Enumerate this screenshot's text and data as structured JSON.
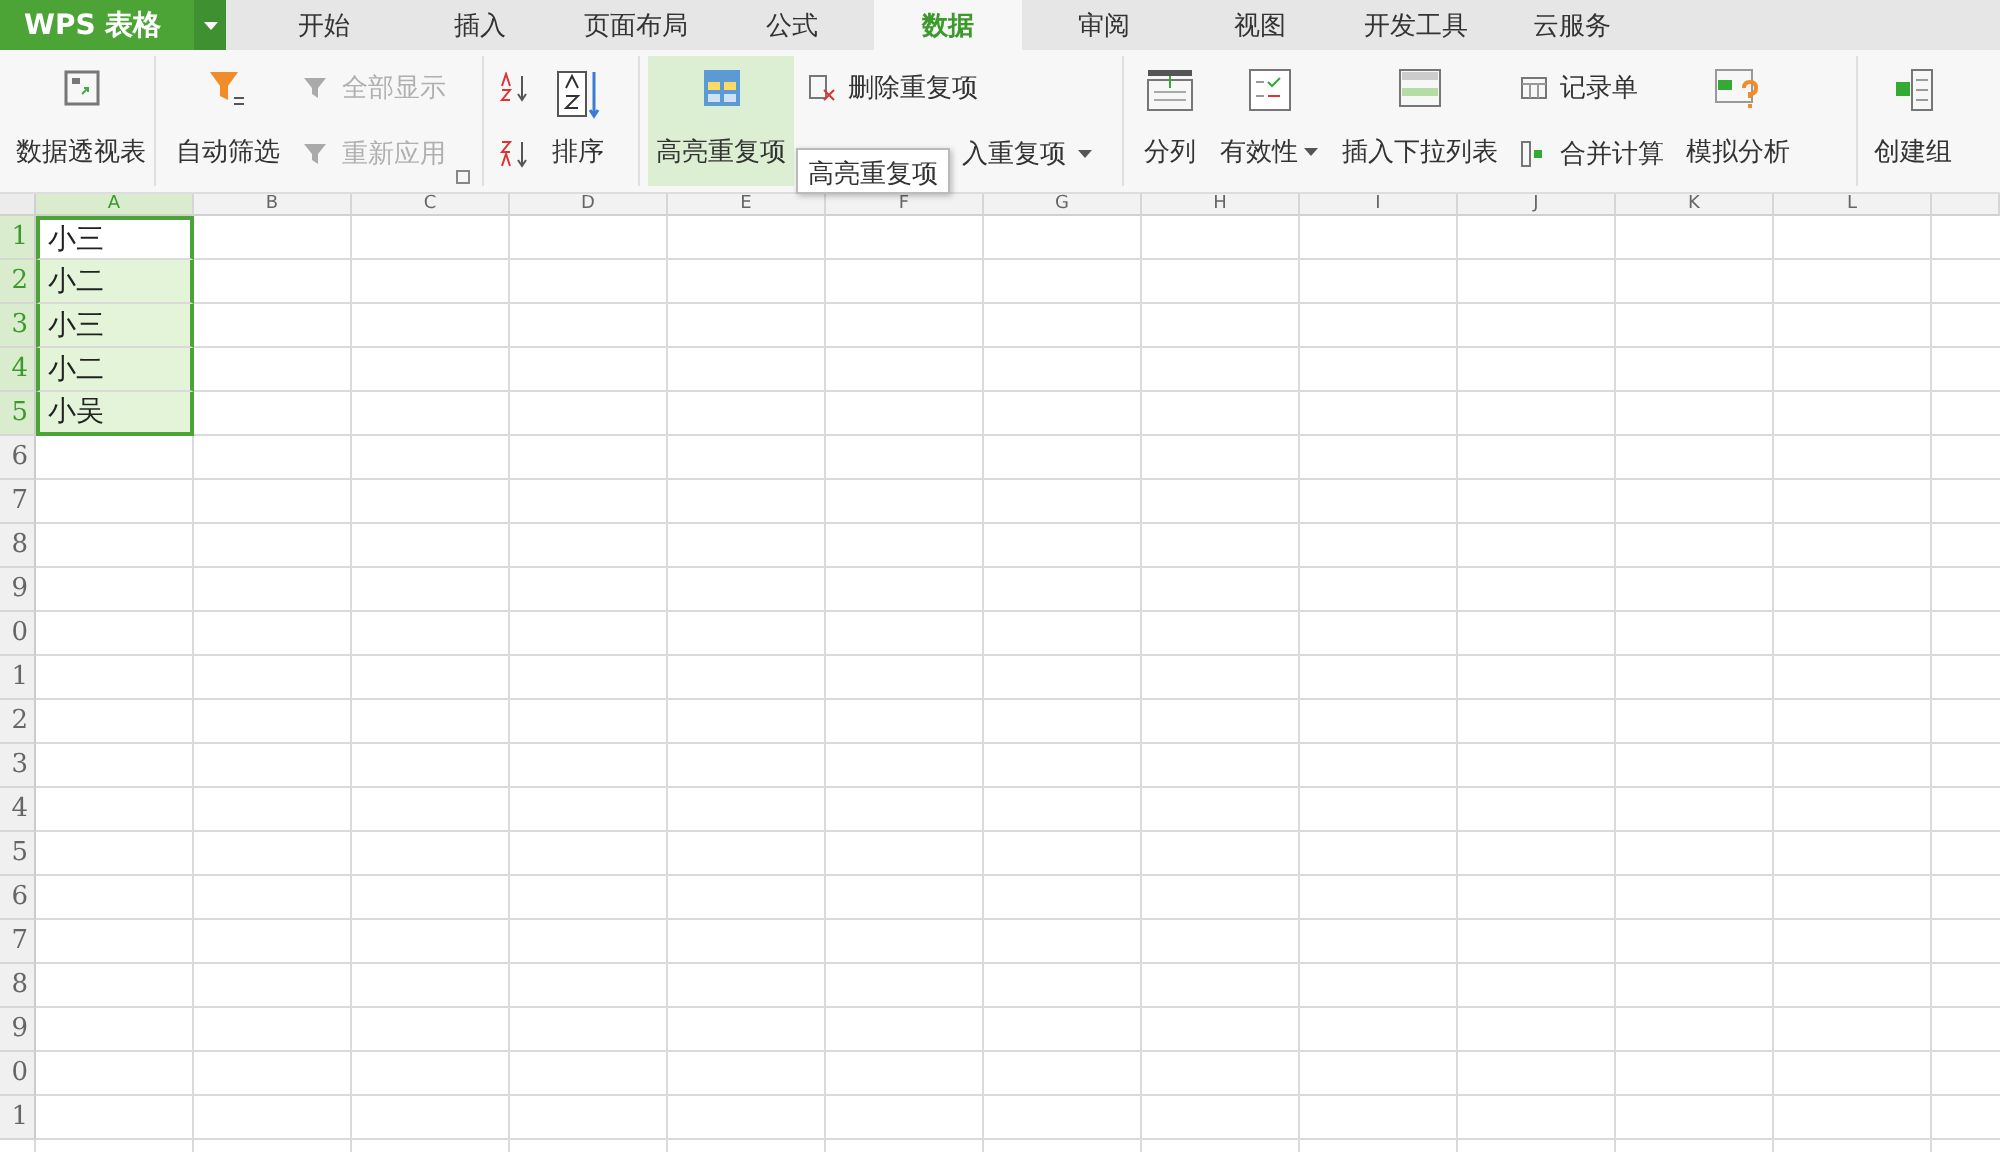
{
  "app_menu": {
    "label": "WPS 表格"
  },
  "tabs": [
    {
      "label": "开始",
      "selected": false
    },
    {
      "label": "插入",
      "selected": false
    },
    {
      "label": "页面布局",
      "selected": false
    },
    {
      "label": "公式",
      "selected": false
    },
    {
      "label": "数据",
      "selected": true
    },
    {
      "label": "审阅",
      "selected": false
    },
    {
      "label": "视图",
      "selected": false
    },
    {
      "label": "开发工具",
      "selected": false
    },
    {
      "label": "云服务",
      "selected": false
    }
  ],
  "ribbon": {
    "pivot_table": {
      "label": "数据透视表"
    },
    "auto_filter": {
      "label": "自动筛选"
    },
    "show_all": {
      "label": "全部显示",
      "disabled": true
    },
    "reapply": {
      "label": "重新应用",
      "disabled": true
    },
    "sort": {
      "label": "排序"
    },
    "highlight_duplicates": {
      "label": "高亮重复项",
      "highlighted": true
    },
    "delete_duplicates": {
      "label": "删除重复项",
      "disabled": false
    },
    "reject_duplicates": {
      "label": "入重复项",
      "disabled": false
    },
    "text_to_columns": {
      "label": "分列"
    },
    "validation": {
      "label": "有效性"
    },
    "insert_dropdown": {
      "label": "插入下拉列表"
    },
    "record_form": {
      "label": "记录单",
      "disabled": false
    },
    "consolidate": {
      "label": "合并计算",
      "disabled": false
    },
    "what_if": {
      "label": "模拟分析"
    },
    "create_group": {
      "label": "创建组"
    }
  },
  "tooltip": {
    "text": "高亮重复项"
  },
  "sheet": {
    "columns": [
      {
        "label": "A",
        "selected": true
      },
      {
        "label": "B",
        "selected": false
      },
      {
        "label": "C",
        "selected": false
      },
      {
        "label": "D",
        "selected": false
      },
      {
        "label": "E",
        "selected": false
      },
      {
        "label": "F",
        "selected": false
      },
      {
        "label": "G",
        "selected": false
      },
      {
        "label": "H",
        "selected": false
      },
      {
        "label": "I",
        "selected": false
      },
      {
        "label": "J",
        "selected": false
      },
      {
        "label": "K",
        "selected": false
      },
      {
        "label": "L",
        "selected": false
      }
    ],
    "rows": [
      {
        "number": "1",
        "selected": true,
        "cells": [
          {
            "text": "小三",
            "selected": true,
            "active": true
          }
        ]
      },
      {
        "number": "2",
        "selected": true,
        "cells": [
          {
            "text": "小二",
            "selected": true,
            "active": false
          }
        ]
      },
      {
        "number": "3",
        "selected": true,
        "cells": [
          {
            "text": "小三",
            "selected": true,
            "active": false
          }
        ]
      },
      {
        "number": "4",
        "selected": true,
        "cells": [
          {
            "text": "小二",
            "selected": true,
            "active": false
          }
        ]
      },
      {
        "number": "5",
        "selected": true,
        "cells": [
          {
            "text": "小吴",
            "selected": true,
            "active": false
          }
        ]
      },
      {
        "number": "6",
        "selected": false
      },
      {
        "number": "7",
        "selected": false
      },
      {
        "number": "8",
        "selected": false
      },
      {
        "number": "9",
        "selected": false
      },
      {
        "number": "0",
        "selected": false
      },
      {
        "number": "1",
        "selected": false
      },
      {
        "number": "2",
        "selected": false
      },
      {
        "number": "3",
        "selected": false
      },
      {
        "number": "4",
        "selected": false
      },
      {
        "number": "5",
        "selected": false
      },
      {
        "number": "6",
        "selected": false
      },
      {
        "number": "7",
        "selected": false
      },
      {
        "number": "8",
        "selected": false
      },
      {
        "number": "9",
        "selected": false
      },
      {
        "number": "0",
        "selected": false
      },
      {
        "number": "1",
        "selected": false
      }
    ]
  }
}
